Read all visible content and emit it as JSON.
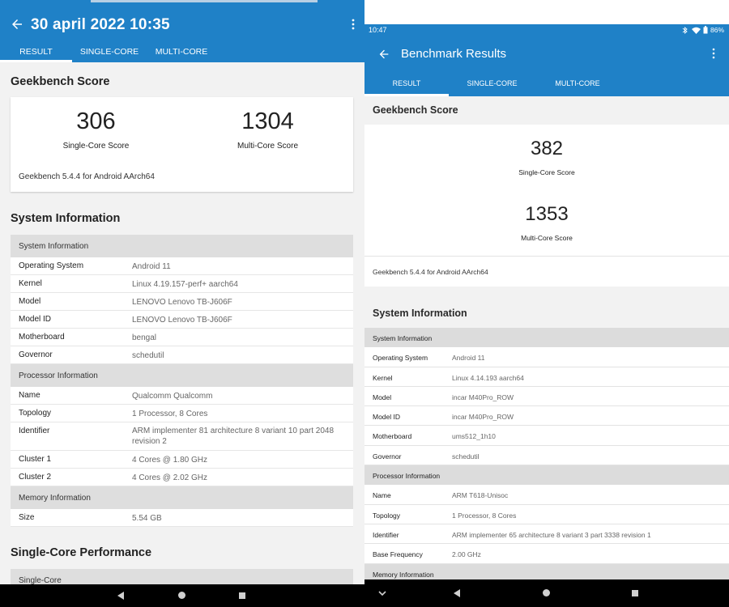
{
  "left": {
    "title": "30 april 2022 10:35",
    "tabs": [
      "RESULT",
      "SINGLE-CORE",
      "MULTI-CORE"
    ],
    "score_section": "Geekbench Score",
    "single_score": "306",
    "single_label": "Single-Core Score",
    "multi_score": "1304",
    "multi_label": "Multi-Core Score",
    "version": "Geekbench 5.4.4 for Android AArch64",
    "sysinfo_section": "System Information",
    "rows": [
      {
        "k": "System Information",
        "v": "",
        "hdr": true
      },
      {
        "k": "Operating System",
        "v": "Android 11"
      },
      {
        "k": "Kernel",
        "v": "Linux 4.19.157-perf+ aarch64"
      },
      {
        "k": "Model",
        "v": "LENOVO Lenovo TB-J606F"
      },
      {
        "k": "Model ID",
        "v": "LENOVO Lenovo TB-J606F"
      },
      {
        "k": "Motherboard",
        "v": "bengal"
      },
      {
        "k": "Governor",
        "v": "schedutil"
      },
      {
        "k": "Processor Information",
        "v": "",
        "hdr": true
      },
      {
        "k": "Name",
        "v": "Qualcomm Qualcomm"
      },
      {
        "k": "Topology",
        "v": "1 Processor, 8 Cores"
      },
      {
        "k": "Identifier",
        "v": "ARM implementer 81 architecture 8 variant 10 part 2048 revision 2"
      },
      {
        "k": "Cluster 1",
        "v": "4 Cores @ 1.80 GHz"
      },
      {
        "k": "Cluster 2",
        "v": "4 Cores @ 2.02 GHz"
      },
      {
        "k": "Memory Information",
        "v": "",
        "hdr": true
      },
      {
        "k": "Size",
        "v": "5.54 GB"
      }
    ],
    "perf_section": "Single-Core Performance",
    "perf_header": "Single-Core"
  },
  "right": {
    "time": "10:47",
    "battery": "86%",
    "title": "Benchmark Results",
    "tabs": [
      "RESULT",
      "SINGLE-CORE",
      "MULTI-CORE"
    ],
    "score_section": "Geekbench Score",
    "single_score": "382",
    "single_label": "Single-Core Score",
    "multi_score": "1353",
    "multi_label": "Multi-Core Score",
    "version": "Geekbench 5.4.4 for Android AArch64",
    "sysinfo_section": "System Information",
    "rows": [
      {
        "k": "System Information",
        "v": "",
        "hdr": true
      },
      {
        "k": "Operating System",
        "v": "Android 11"
      },
      {
        "k": "Kernel",
        "v": "Linux 4.14.193 aarch64"
      },
      {
        "k": "Model",
        "v": "incar M40Pro_ROW"
      },
      {
        "k": "Model ID",
        "v": "incar M40Pro_ROW"
      },
      {
        "k": "Motherboard",
        "v": "ums512_1h10"
      },
      {
        "k": "Governor",
        "v": "schedutil"
      },
      {
        "k": "Processor Information",
        "v": "",
        "hdr": true
      },
      {
        "k": "Name",
        "v": "ARM T618-Unisoc"
      },
      {
        "k": "Topology",
        "v": "1 Processor, 8 Cores"
      },
      {
        "k": "Identifier",
        "v": "ARM implementer 65 architecture 8 variant 3 part 3338 revision 1"
      },
      {
        "k": "Base Frequency",
        "v": "2.00 GHz"
      },
      {
        "k": "Memory Information",
        "v": "",
        "hdr": true
      }
    ]
  },
  "icons": {
    "back": "back-arrow-icon",
    "more": "more-vert-icon",
    "nav_back": "nav-back-icon",
    "nav_home": "nav-home-icon",
    "nav_recents": "nav-recents-icon"
  },
  "colors": {
    "accent": "#1f81c7",
    "background": "#f2f2f2",
    "header_row": "#dedede"
  }
}
